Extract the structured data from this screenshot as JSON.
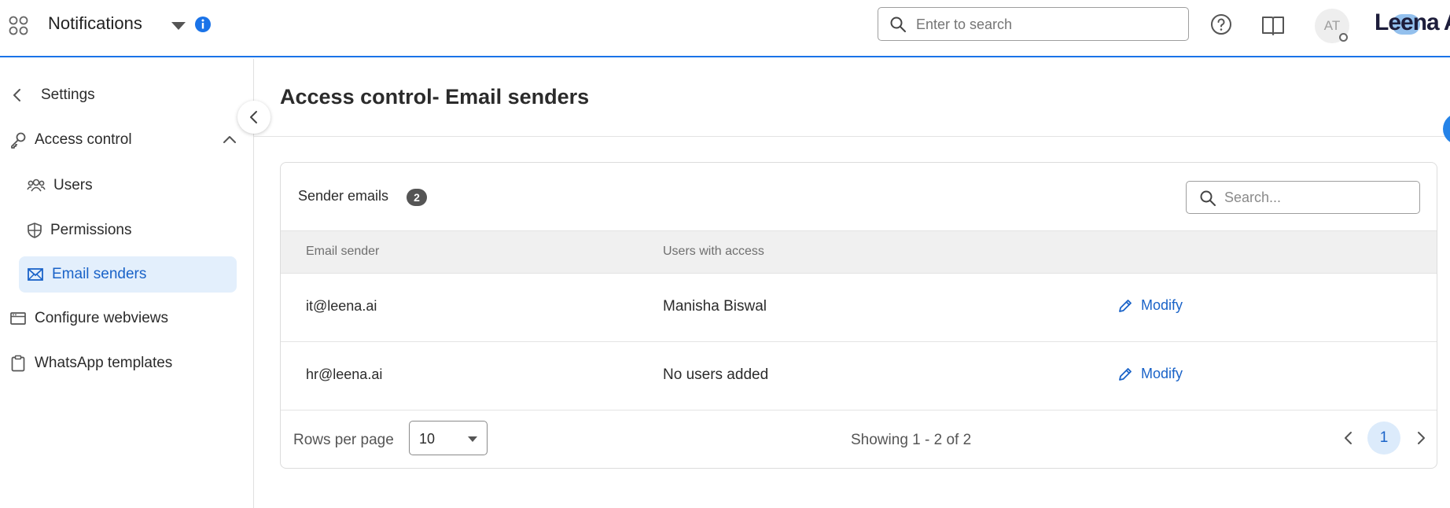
{
  "header": {
    "app_title": "Notifications",
    "search_placeholder": "Enter to search",
    "avatar_initials": "AT",
    "brand": "Leena A",
    "accent_color": "#1a73e8"
  },
  "sidebar": {
    "back_label": "Settings",
    "section_label": "Access control",
    "items": [
      {
        "label": "Users",
        "icon": "users-icon"
      },
      {
        "label": "Permissions",
        "icon": "shield-icon"
      },
      {
        "label": "Email senders",
        "icon": "mail-icon",
        "active": true
      }
    ],
    "other_items": [
      {
        "label": "Configure webviews",
        "icon": "browser-window-icon"
      },
      {
        "label": "WhatsApp templates",
        "icon": "clipboard-icon"
      }
    ]
  },
  "main": {
    "page_title": "Access control- Email senders",
    "card": {
      "title": "Sender emails",
      "count": "2",
      "search_placeholder": "Search...",
      "columns": [
        "Email sender",
        "Users with access"
      ],
      "rows": [
        {
          "email": "it@leena.ai",
          "users": "Manisha Biswal",
          "action": "Modify"
        },
        {
          "email": "hr@leena.ai",
          "users": "No users added",
          "action": "Modify"
        }
      ],
      "footer": {
        "rows_per_page_label": "Rows per page",
        "rows_per_page_value": "10",
        "showing_text": "Showing 1 - 2 of 2",
        "current_page": "1"
      }
    }
  }
}
